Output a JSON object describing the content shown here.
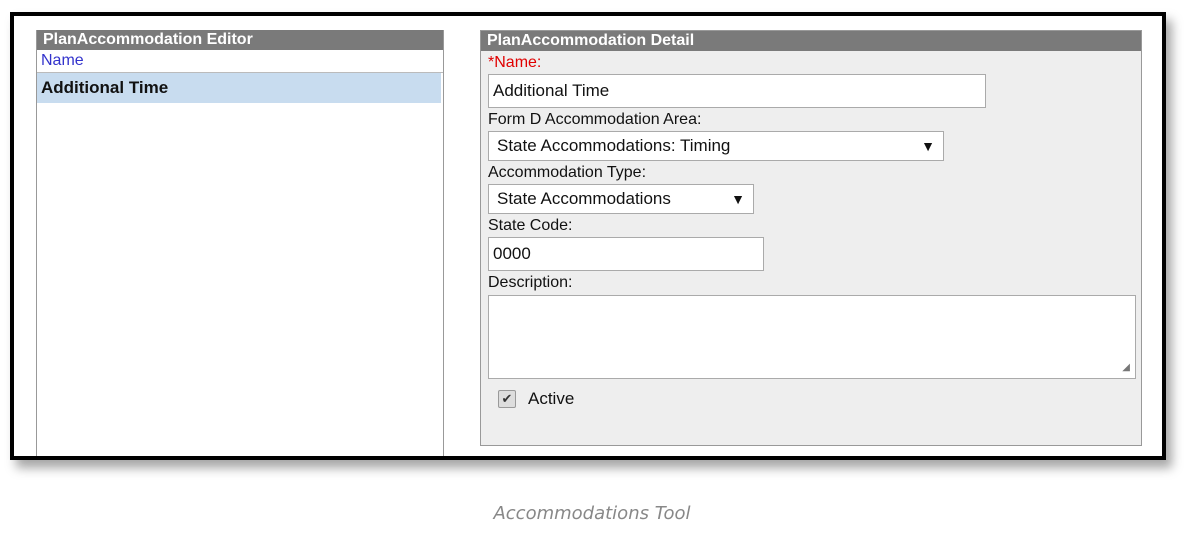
{
  "editor": {
    "header": "PlanAccommodation Editor",
    "column_header": "Name",
    "items": [
      {
        "label": "Additional Time",
        "selected": true
      }
    ]
  },
  "detail": {
    "header": "PlanAccommodation Detail",
    "name_required_mark": "*",
    "name_label": "Name:",
    "name_value": "Additional Time",
    "area_label": "Form D Accommodation Area:",
    "area_value": "State Accommodations: Timing",
    "type_label": "Accommodation Type:",
    "type_value": "State Accommodations",
    "state_code_label": "State Code:",
    "state_code_value": "0000",
    "description_label": "Description:",
    "description_value": "",
    "active_label": "Active",
    "active_checked": true
  },
  "caption": "Accommodations Tool",
  "icons": {
    "dropdown": "chevron-down-icon",
    "check": "checkmark-icon",
    "resize": "resize-grip-icon"
  },
  "colors": {
    "header_bg": "#7a7a7a",
    "selected_row": "#c8dcef",
    "required": "#e00000",
    "column_link": "#3333cc"
  }
}
